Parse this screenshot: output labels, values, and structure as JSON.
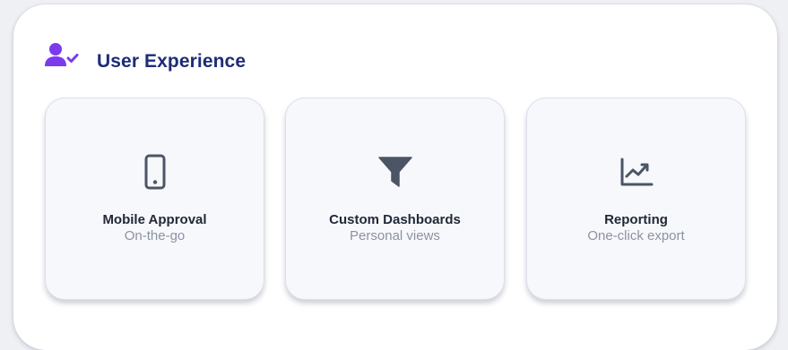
{
  "section": {
    "title": "User Experience",
    "icon": "user-check-icon",
    "accent_color": "#7c3aed",
    "title_color": "#1e2b78"
  },
  "cards": [
    {
      "icon": "smartphone-icon",
      "title": "Mobile Approval",
      "subtitle": "On-the-go"
    },
    {
      "icon": "filter-icon",
      "title": "Custom Dashboards",
      "subtitle": "Personal views"
    },
    {
      "icon": "chart-line-icon",
      "title": "Reporting",
      "subtitle": "One-click export"
    }
  ],
  "colors": {
    "icon_gray": "#4b5565",
    "card_bg": "#f7f8fb",
    "subtitle": "#8b92a1"
  }
}
